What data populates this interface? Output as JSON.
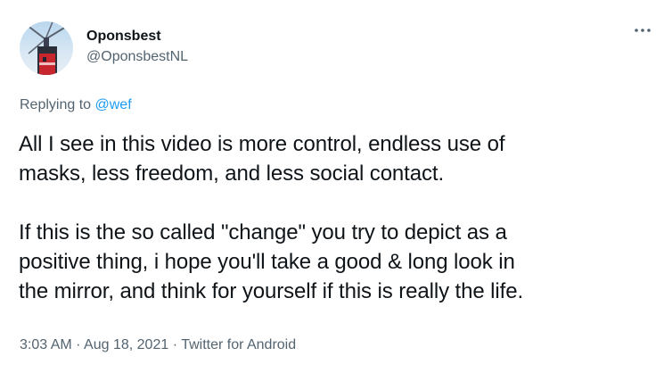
{
  "user": {
    "display_name": "Oponsbest",
    "handle": "@OponsbestNL"
  },
  "more_icon": "more-horizontal-icon",
  "reply": {
    "prefix": "Replying to ",
    "target": "@wef"
  },
  "tweet": {
    "paragraph_1": "All I see in this video is more control, endless use of\nmasks, less freedom, and less social contact.",
    "paragraph_2": "If this is the so called \"change\" you try to depict as a\npositive thing, i hope you'll take a good & long look in\nthe mirror, and think for yourself if this is really the life."
  },
  "meta": {
    "time": "3:03 AM",
    "separator": " · ",
    "date": "Aug 18, 2021",
    "source": "Twitter for Android"
  },
  "colors": {
    "text": "#0f1419",
    "secondary": "#536471",
    "link": "#1d9bf0"
  }
}
